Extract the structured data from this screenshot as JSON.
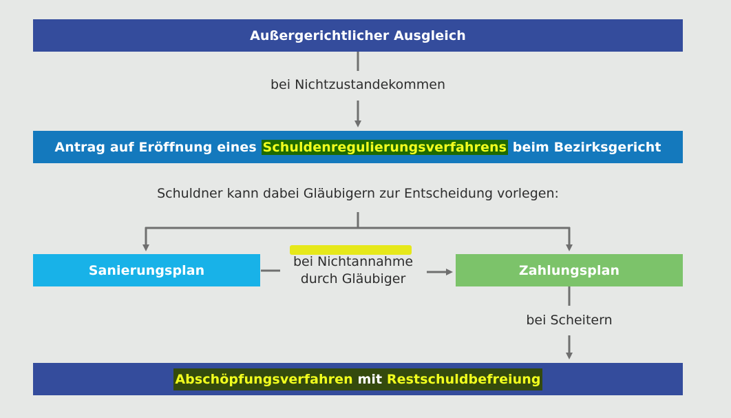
{
  "diagram": {
    "top_box": {
      "label": "Außergerichtlicher Ausgleich",
      "color": "#344c9c"
    },
    "arrow1_label": "bei Nichtzustandekommen",
    "antrag_box": {
      "prefix": "Antrag auf Eröffnung eines ",
      "highlight": "Schuldenregulierungsverfahrens",
      "suffix": " beim Bezirksgericht",
      "color": "#1479bd"
    },
    "split_label": "Schuldner kann dabei Gläubigern zur Entscheidung vorlegen:",
    "sanierung_box": {
      "label": "Sanierungsplan",
      "color": "#18b2e8"
    },
    "nichtannahme_label": {
      "line1": "bei Nichtannahme",
      "line2": "durch Gläubiger"
    },
    "zahlung_box": {
      "label": "Zahlungsplan",
      "color": "#7cc36a"
    },
    "scheitern_label": "bei Scheitern",
    "bottom_box": {
      "part1": "Abschöpfungsverfahren",
      "middle": " mit ",
      "part2": "Restschuldbefreiung",
      "color": "#344c9c"
    },
    "connector_color": "#6f6f6f",
    "highlight_color": "#f2ff1e"
  }
}
